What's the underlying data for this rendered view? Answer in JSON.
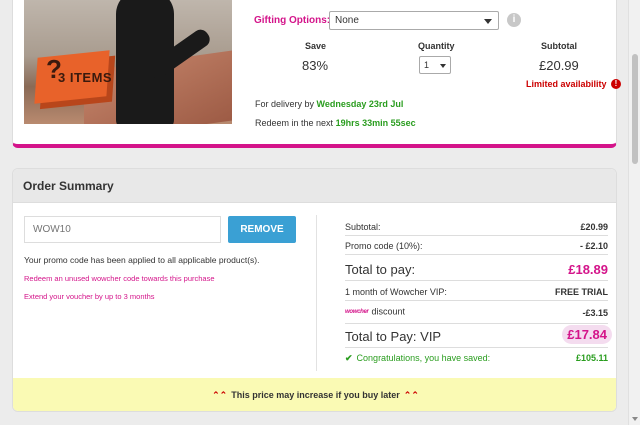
{
  "product": {
    "image_box_text": "3 ITEMS",
    "image_box_symbol": "?",
    "gifting_label": "Gifting Options:",
    "gifting_value": "None",
    "info_symbol": "i",
    "save_label": "Save",
    "save_value": "83%",
    "quantity_label": "Quantity",
    "quantity_value": "1",
    "subtotal_label": "Subtotal",
    "subtotal_value": "£20.99",
    "limited_label": "Limited availability",
    "alert_symbol": "!",
    "delivery_prefix": "For delivery by ",
    "delivery_date": "Wednesday 23rd Jul",
    "redeem_prefix": "Redeem in the next ",
    "redeem_countdown": "19hrs 33min 55sec"
  },
  "summary": {
    "title": "Order Summary",
    "promo_placeholder": "WOW10",
    "remove_label": "REMOVE",
    "applied_text": "Your promo code has been applied to all applicable product(s).",
    "link_redeem": "Redeem an unused wowcher code towards this purchase",
    "link_extend": "Extend your voucher by up to 3 months",
    "rows": {
      "subtotal_label": "Subtotal:",
      "subtotal_value": "£20.99",
      "promo_label": "Promo code (10%):",
      "promo_value": "- £2.10",
      "total_label": "Total to pay:",
      "total_value": "£18.89",
      "vip_label": "1 month of Wowcher VIP:",
      "vip_value": "FREE TRIAL",
      "discount_logo": "wowcher",
      "discount_label": "discount",
      "discount_value": "-£3.15",
      "vip_total_label": "Total to Pay: VIP",
      "vip_total_value": "£17.84",
      "congrats_word": "Congratulations",
      "congrats_rest": ", you have saved:",
      "saved_value": "£105.11"
    },
    "warning": "This price may increase if you buy later",
    "warning_chevron": "⌃"
  },
  "colors": {
    "brand_pink": "#d4148a",
    "success_green": "#2a9d1f",
    "button_blue": "#3aa0d4",
    "warning_bg": "#fafab4"
  }
}
